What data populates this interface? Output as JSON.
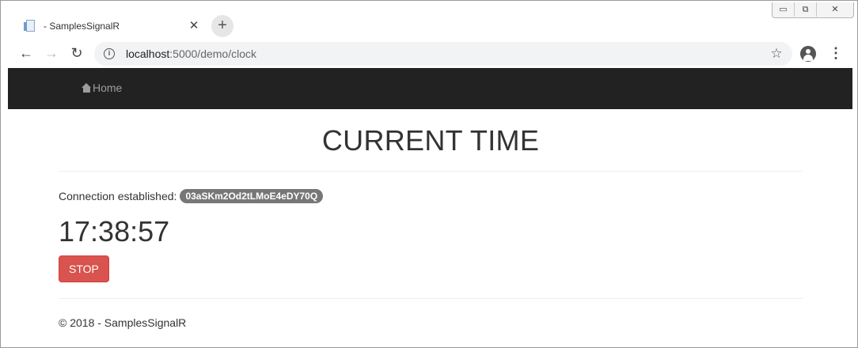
{
  "browser": {
    "tab": {
      "title": "- SamplesSignalR",
      "close_glyph": "✕",
      "favicon": "page-icon"
    },
    "new_tab_glyph": "+",
    "window_controls": {
      "minimize": "▭",
      "maximize": "⧉",
      "close": "✕✕"
    },
    "nav": {
      "back": "←",
      "forward": "→",
      "reload": "↻"
    },
    "address": {
      "host": "localhost",
      "path": ":5000/demo/clock"
    },
    "icons": {
      "info": "i",
      "star": "☆",
      "menu": "⋮"
    }
  },
  "page": {
    "navbar": {
      "home_label": "Home"
    },
    "title": "CURRENT TIME",
    "connection": {
      "label": "Connection established:",
      "id": "03aSKm2Od2tLMoE4eDY70Q"
    },
    "clock": "17:38:57",
    "stop_label": "STOP",
    "footer": "© 2018 - SamplesSignalR"
  },
  "colors": {
    "navbar_bg": "#222222",
    "nav_link": "#9d9d9d",
    "badge_bg": "#777777",
    "danger": "#d9534f"
  }
}
